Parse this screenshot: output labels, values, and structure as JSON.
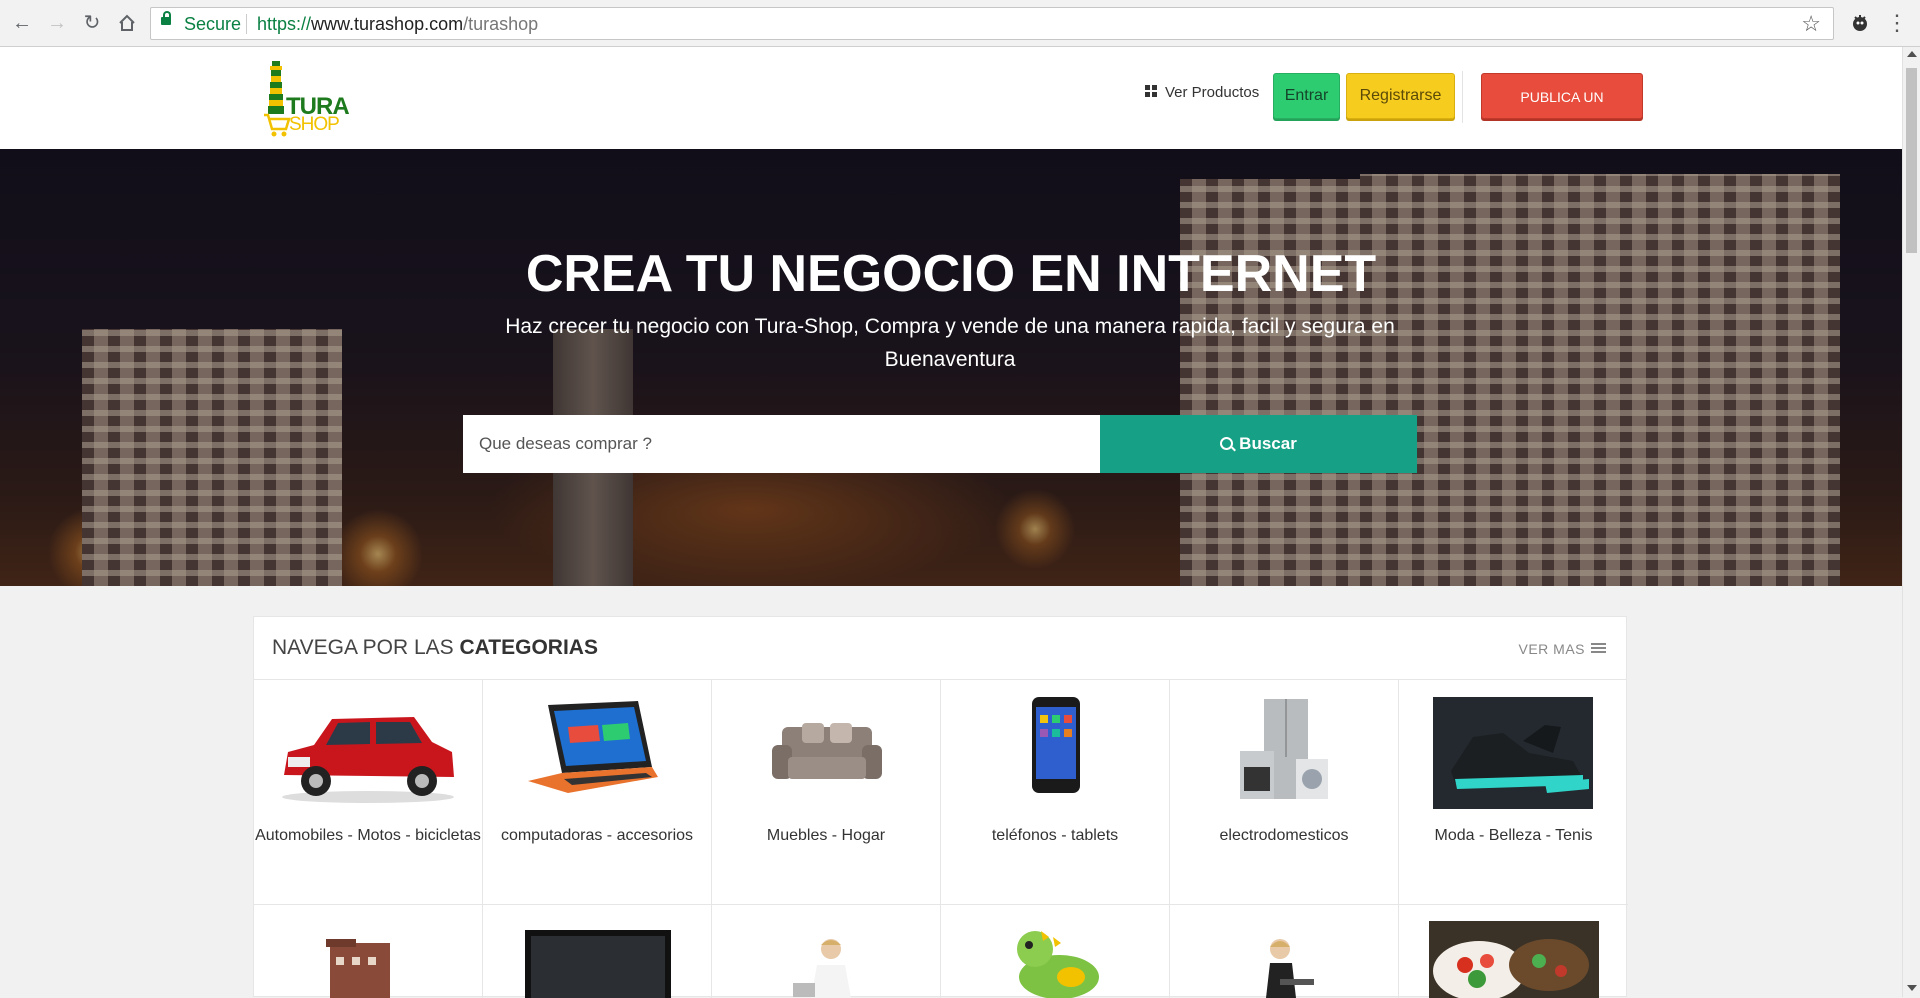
{
  "browser": {
    "secure_label": "Secure",
    "url_scheme": "https://",
    "url_host": "www.turashop.com",
    "url_path": "/turashop"
  },
  "header": {
    "logo_tura": "TURA",
    "logo_shop": "SHOP",
    "ver_productos": "Ver Productos",
    "entrar": "Entrar",
    "registrarse": "Registrarse",
    "publica": "PUBLICA UN PRODUCTO",
    "colors": {
      "entrar": "#2ecc71",
      "registrarse": "#f6cc1f",
      "publica": "#e74c3c"
    }
  },
  "hero": {
    "title": "CREA TU NEGOCIO EN INTERNET",
    "subtitle": "Haz crecer tu negocio con Tura-Shop, Compra y vende de una manera rapida, facil y segura en Buenaventura",
    "search_placeholder": "Que deseas comprar ?",
    "search_button": "Buscar",
    "accent": "#16a085"
  },
  "categories": {
    "title_light": "NAVEGA POR LAS ",
    "title_bold": "CATEGORIAS",
    "ver_mas": "VER MAS",
    "items": [
      {
        "label": "Automobiles - Motos - bicicletas",
        "icon": "car-image"
      },
      {
        "label": "computadoras - accesorios",
        "icon": "laptop-image"
      },
      {
        "label": "Muebles - Hogar",
        "icon": "sofa-image"
      },
      {
        "label": "teléfonos - tablets",
        "icon": "phone-image"
      },
      {
        "label": "electrodomesticos",
        "icon": "appliances-image"
      },
      {
        "label": "Moda - Belleza - Tenis",
        "icon": "sneaker-image"
      }
    ],
    "second_row_icons": [
      "building-image",
      "tv-image",
      "nurse-image",
      "toy-dinosaur-image",
      "office-worker-image",
      "food-image"
    ]
  }
}
